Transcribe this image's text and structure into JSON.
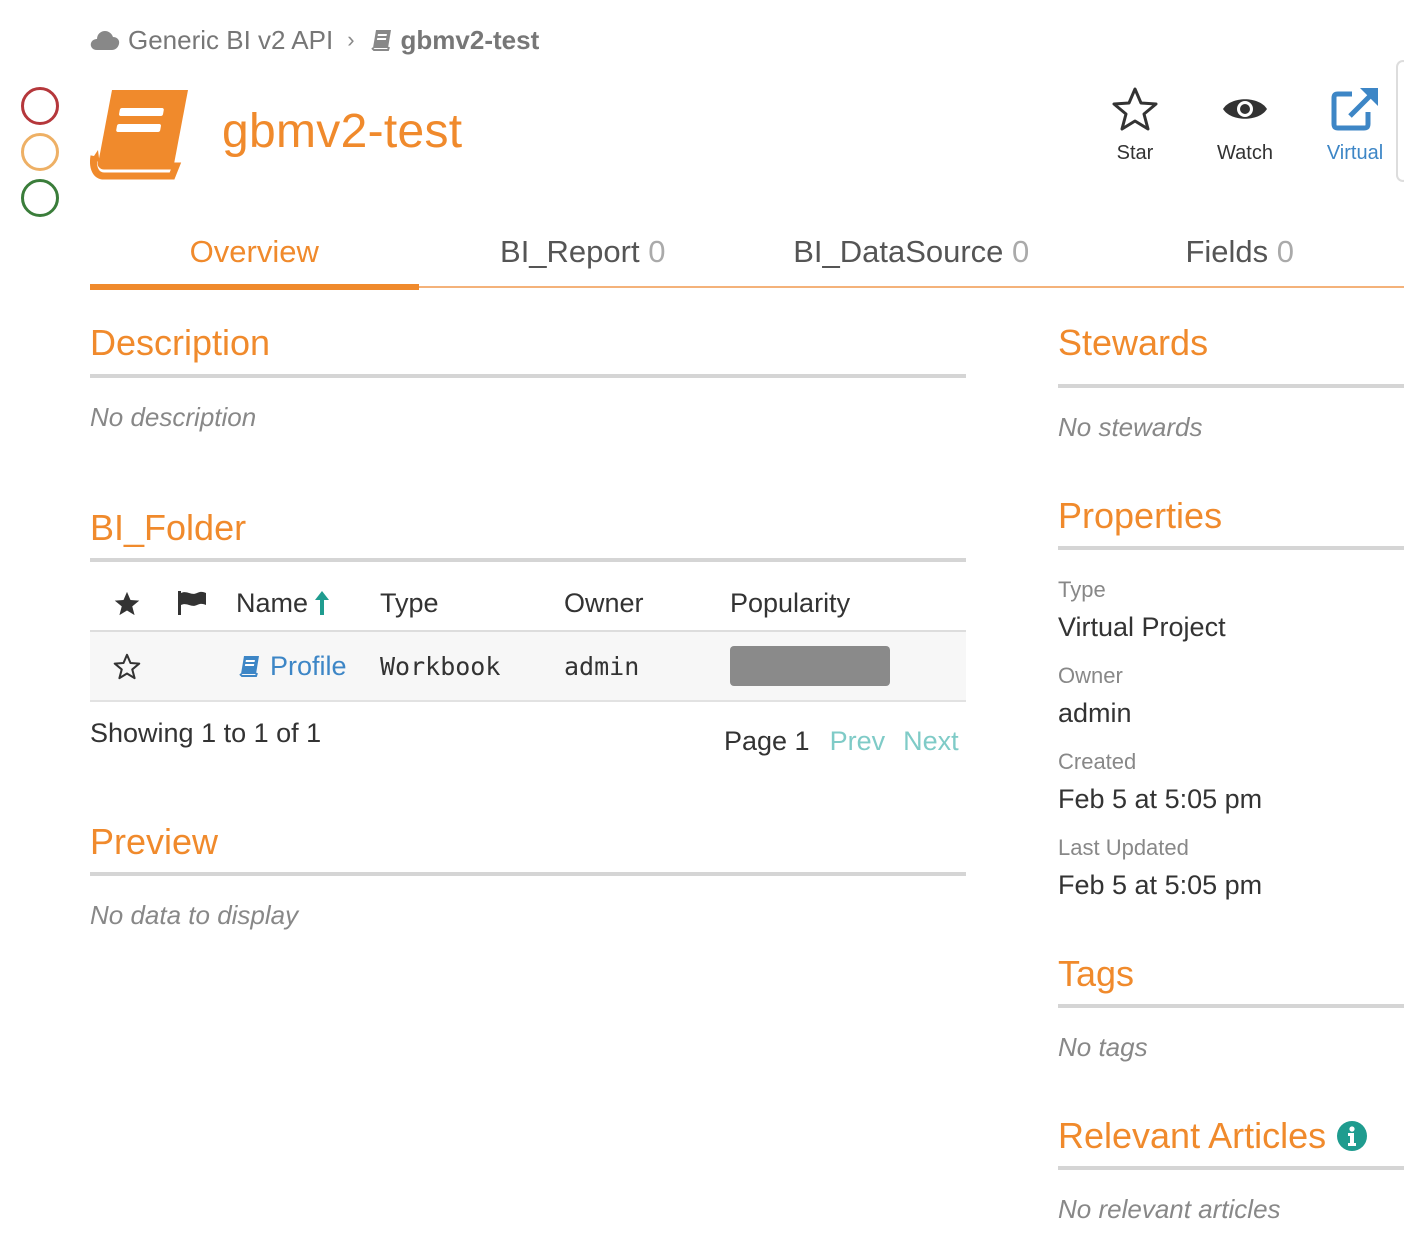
{
  "breadcrumb": {
    "parent": "Generic BI v2 API",
    "current": "gbmv2-test"
  },
  "page": {
    "title": "gbmv2-test"
  },
  "actions": {
    "star": "Star",
    "watch": "Watch",
    "virtual": "Virtual"
  },
  "tabs": [
    {
      "label": "Overview",
      "count": ""
    },
    {
      "label": "BI_Report",
      "count": "0"
    },
    {
      "label": "BI_DataSource",
      "count": "0"
    },
    {
      "label": "Fields",
      "count": "0"
    }
  ],
  "description": {
    "title": "Description",
    "empty": "No description"
  },
  "folder": {
    "title": "BI_Folder",
    "columns": {
      "name": "Name",
      "type": "Type",
      "owner": "Owner",
      "popularity": "Popularity"
    },
    "rows": [
      {
        "name": "Profile",
        "type": "Workbook",
        "owner": "admin"
      }
    ],
    "showing": "Showing 1 to 1 of 1",
    "page": "Page 1",
    "prev": "Prev",
    "next": "Next"
  },
  "preview": {
    "title": "Preview",
    "empty": "No data to display"
  },
  "stewards": {
    "title": "Stewards",
    "empty": "No stewards"
  },
  "properties": {
    "title": "Properties",
    "type_label": "Type",
    "type_value": "Virtual Project",
    "owner_label": "Owner",
    "owner_value": "admin",
    "created_label": "Created",
    "created_value": "Feb 5 at 5:05 pm",
    "updated_label": "Last Updated",
    "updated_value": "Feb 5 at 5:05 pm"
  },
  "tags": {
    "title": "Tags",
    "empty": "No tags"
  },
  "articles": {
    "title": "Relevant Articles",
    "empty": "No relevant articles"
  },
  "colors": {
    "accent": "#f08a2c",
    "link": "#3d86c6",
    "teal": "#1f9c8f",
    "pager": "#7fcbc7"
  },
  "status_circles": [
    "red",
    "yellow",
    "green"
  ]
}
